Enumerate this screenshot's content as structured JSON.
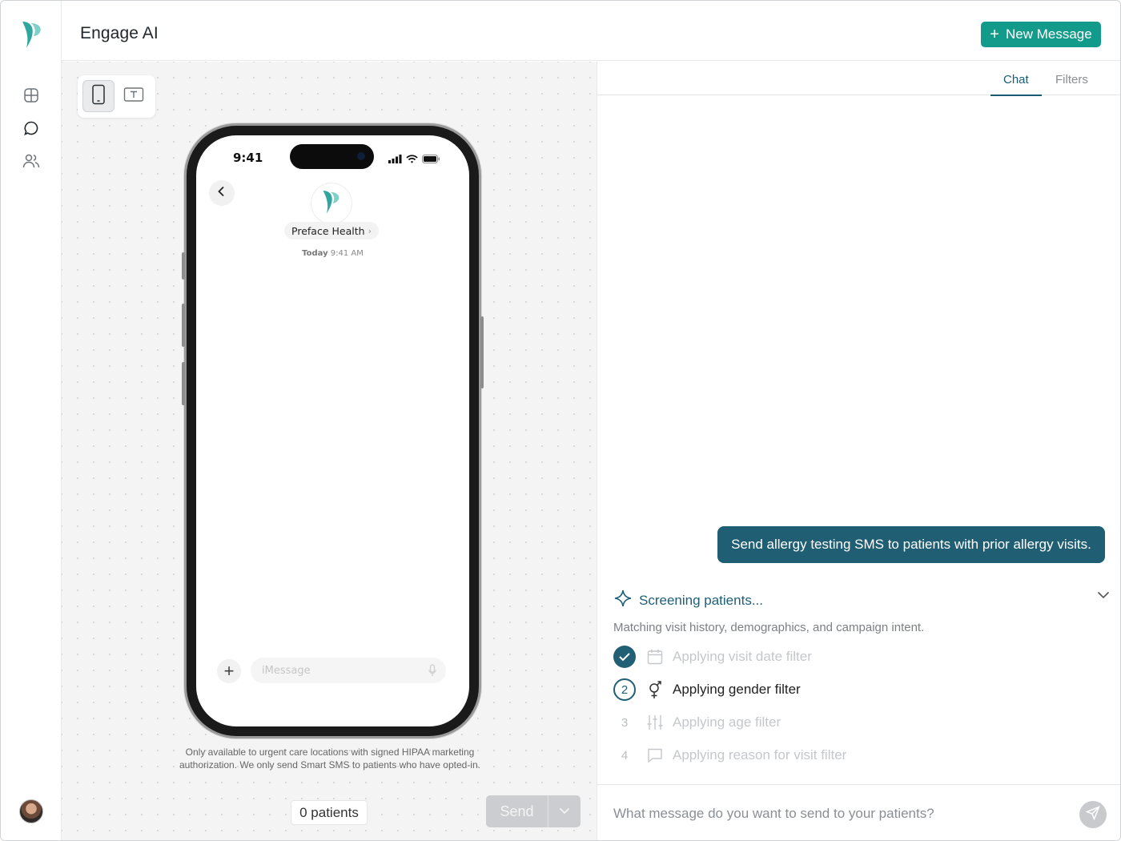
{
  "app": {
    "title": "Engage AI"
  },
  "header": {
    "new_message_label": "New Message"
  },
  "colors": {
    "accent": "#129a8a",
    "brand_dark": "#1f5e73",
    "bubble": "#1f5e73"
  },
  "sidebar": {
    "items": [
      {
        "icon": "dashboard-icon"
      },
      {
        "icon": "chat-bubble-icon"
      },
      {
        "icon": "users-icon"
      }
    ]
  },
  "preview": {
    "view_toggle": [
      {
        "icon": "phone-icon",
        "active": true
      },
      {
        "icon": "text-icon",
        "active": false
      }
    ],
    "phone": {
      "status_time": "9:41",
      "contact_name": "Preface Health",
      "thread_day": "Today",
      "thread_time": "9:41 AM",
      "imessage_placeholder": "iMessage"
    },
    "disclaimer": "Only available to urgent care locations with signed HIPAA marketing authorization. We only send Smart SMS to patients who have opted-in.",
    "patients_count": "0 patients",
    "send_label": "Send"
  },
  "right": {
    "tabs": [
      {
        "label": "Chat",
        "active": true
      },
      {
        "label": "Filters",
        "active": false
      }
    ],
    "user_message": "Send allergy testing SMS to patients with prior allergy visits.",
    "screening": {
      "title": "Screening patients...",
      "subtitle": "Matching visit history, demographics, and campaign intent.",
      "steps": [
        {
          "marker": "",
          "status": "done",
          "icon": "calendar-icon",
          "label": "Applying visit date filter"
        },
        {
          "marker": "2",
          "status": "current",
          "icon": "gender-icon",
          "label": "Applying gender filter"
        },
        {
          "marker": "3",
          "status": "pending",
          "icon": "sliders-icon",
          "label": "Applying age filter"
        },
        {
          "marker": "4",
          "status": "pending",
          "icon": "comment-icon",
          "label": "Applying reason for visit filter"
        }
      ]
    },
    "composer_placeholder": "What message do you want to send to your patients?"
  }
}
